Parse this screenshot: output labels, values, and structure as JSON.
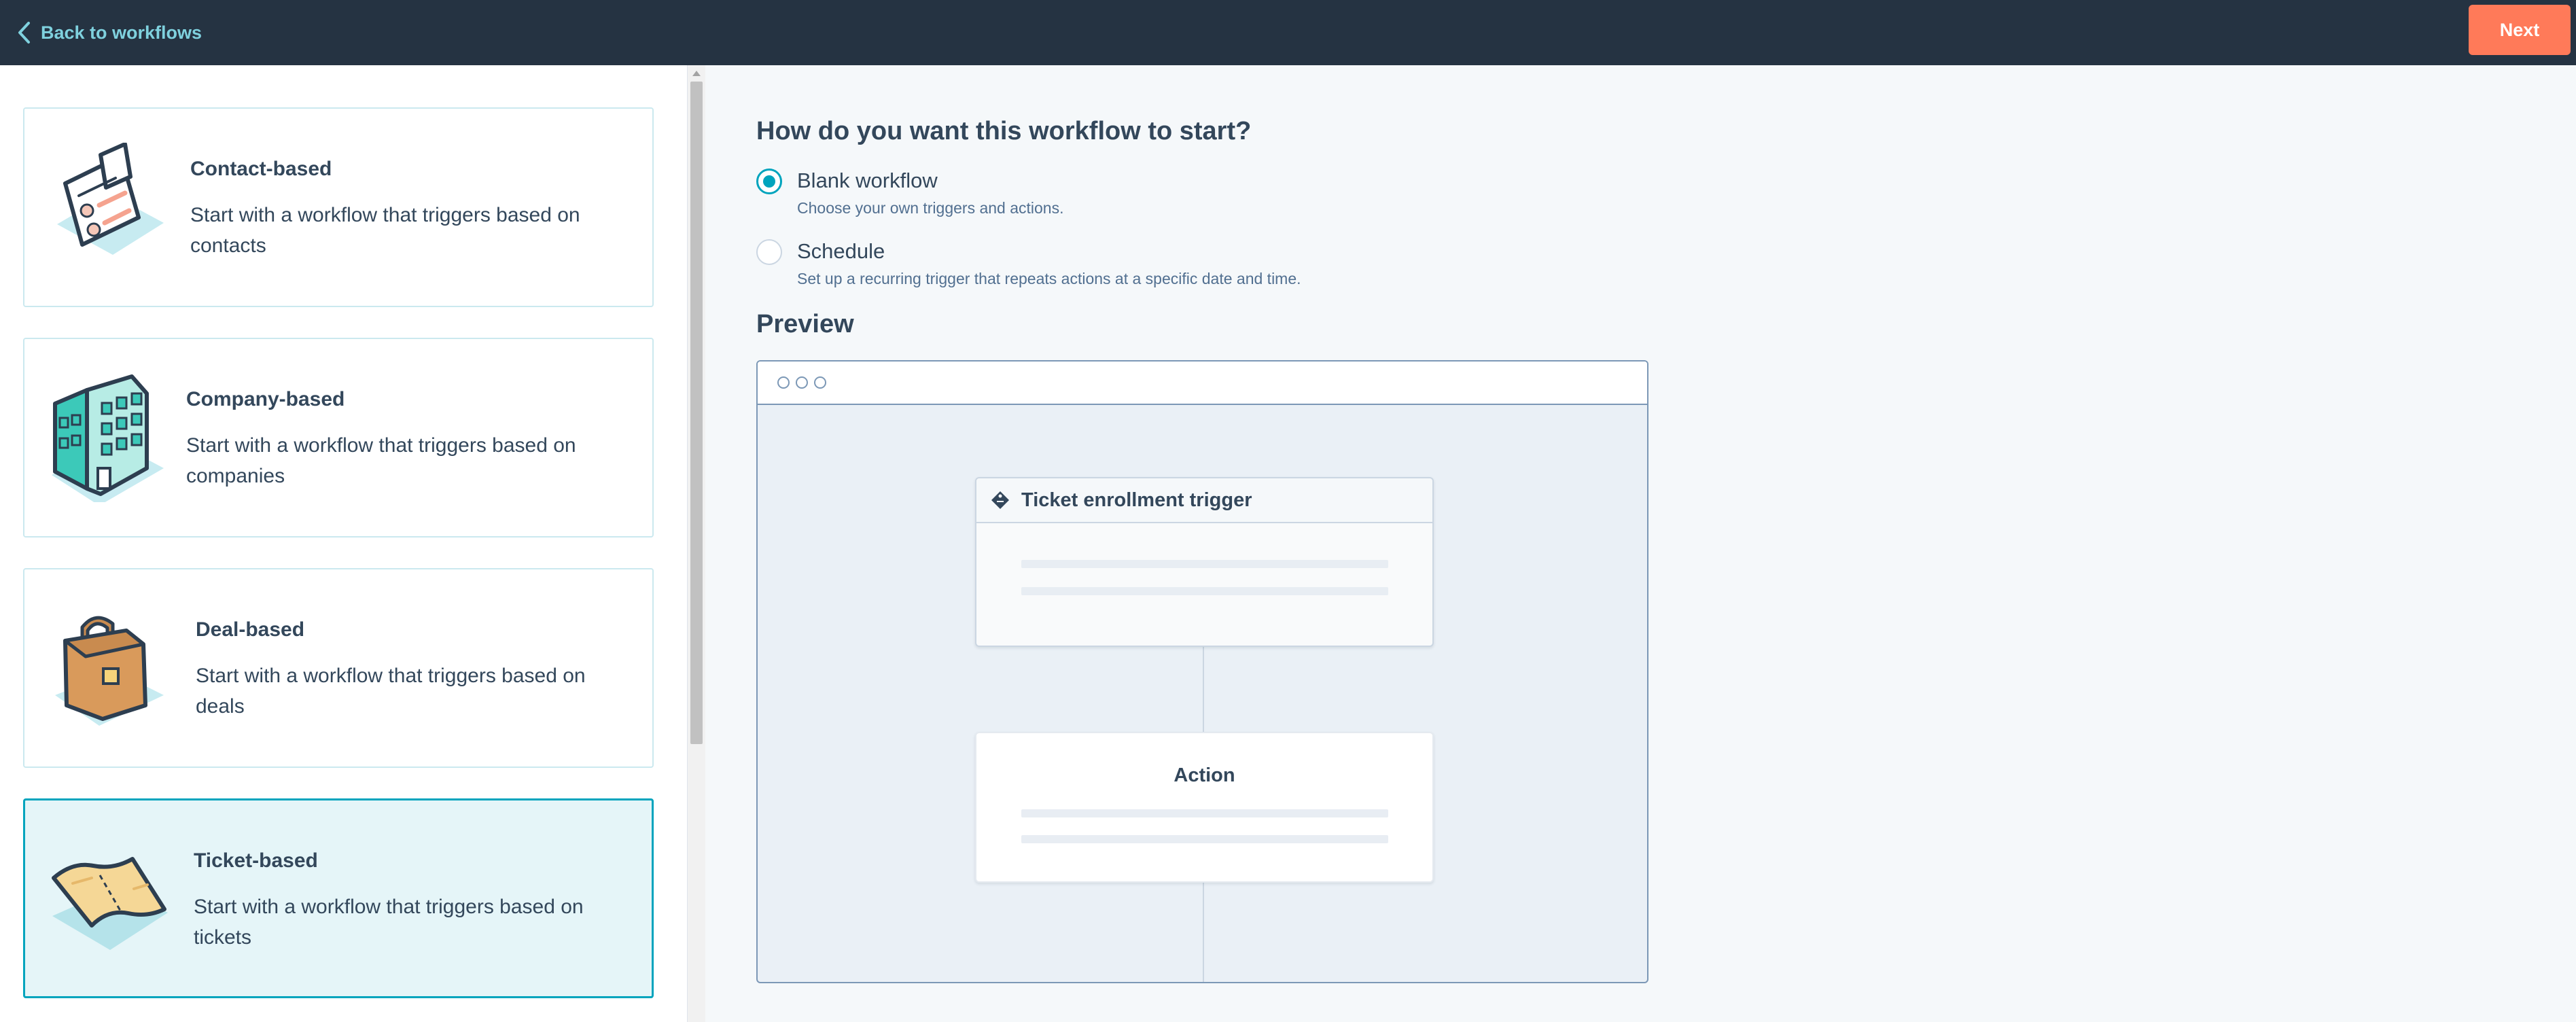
{
  "header": {
    "back_label": "Back to workflows",
    "next_label": "Next"
  },
  "cards": [
    {
      "title": "Contact-based",
      "description": "Start with a workflow that triggers based on contacts",
      "icon": "contact-card-icon",
      "selected": false
    },
    {
      "title": "Company-based",
      "description": "Start with a workflow that triggers based on companies",
      "icon": "building-icon",
      "selected": false
    },
    {
      "title": "Deal-based",
      "description": "Start with a workflow that triggers based on deals",
      "icon": "briefcase-icon",
      "selected": false
    },
    {
      "title": "Ticket-based",
      "description": "Start with a workflow that triggers based on tickets",
      "icon": "ticket-icon",
      "selected": true
    }
  ],
  "start": {
    "question": "How do you want this workflow to start?",
    "options": [
      {
        "label": "Blank workflow",
        "help": "Choose your own triggers and actions.",
        "checked": true
      },
      {
        "label": "Schedule",
        "help": "Set up a recurring trigger that repeats actions at a specific date and time.",
        "checked": false
      }
    ]
  },
  "preview": {
    "title": "Preview",
    "trigger_label": "Ticket enrollment trigger",
    "action_label": "Action"
  },
  "colors": {
    "topbar": "#253342",
    "accent": "#00a4bd",
    "next_button": "#ff7a59",
    "link": "#7fd1de"
  }
}
